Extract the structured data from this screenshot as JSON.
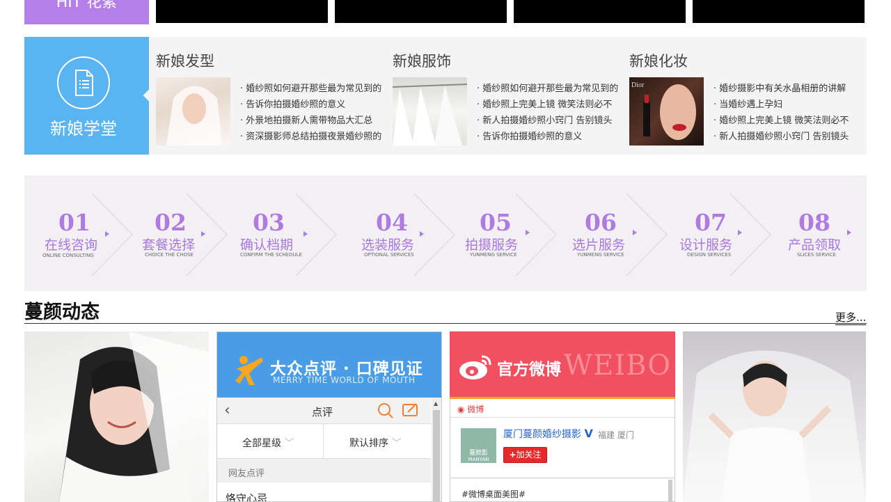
{
  "top": {
    "purple_label": "HIT 花絮"
  },
  "school": {
    "side_title": "新娘学堂",
    "columns": [
      {
        "title": "新娘发型",
        "links": [
          "婚纱照如何避开那些最为常见到的",
          "告诉你拍摄婚纱照的意义",
          "外景地拍摄新人需带物品大汇总",
          "资深摄影师总结拍摄夜景婚纱照的"
        ]
      },
      {
        "title": "新娘服饰",
        "links": [
          "婚纱照如何避开那些最为常见到的",
          "婚纱照上完美上镜 微笑法则必不",
          "新人拍摄婚纱照小窍门 告别镜头",
          "告诉你拍摄婚纱照的意义"
        ]
      },
      {
        "title": "新娘化妆",
        "links": [
          "婚纱摄影中有关水晶相册的讲解",
          "当婚纱遇上孕妇",
          "婚纱照上完美上镜 微笑法则必不",
          "新人拍摄婚纱照小窍门 告别镜头"
        ]
      }
    ]
  },
  "steps": [
    {
      "num": "01",
      "cn": "在线咨询",
      "en": "ONLINE CONSULTING"
    },
    {
      "num": "02",
      "cn": "套餐选择",
      "en": "CHOICE THE CHOSE"
    },
    {
      "num": "03",
      "cn": "确认档期",
      "en": "CONFIRM THE SCHEDULE"
    },
    {
      "num": "04",
      "cn": "选装服务",
      "en": "OPTIONAL SERVICES"
    },
    {
      "num": "05",
      "cn": "拍摄服务",
      "en": "YUNMENG SERVICE"
    },
    {
      "num": "06",
      "cn": "选片服务",
      "en": "YUNMENG SERVICE"
    },
    {
      "num": "07",
      "cn": "设计服务",
      "en": "DESIGN SERVICES"
    },
    {
      "num": "08",
      "cn": "产品领取",
      "en": "SLICES SERVICE"
    }
  ],
  "news": {
    "title": "蔓颜动态",
    "more": "更多..."
  },
  "dianping": {
    "header_title": "大众点评 · 口碑见证",
    "header_sub": "MERRY TIME WORLD OF MOUTH",
    "bar_title": "点评",
    "filter_stars": "全部星级",
    "filter_sort": "默认排序",
    "section": "网友点评",
    "first_user": "恪守心忌"
  },
  "weibo": {
    "header_title": "官方微博",
    "header_en": "WEIBO",
    "bar_label": "微博",
    "account": "厦门蔓颜婚纱摄影",
    "verified": "V",
    "location": "福建 厦门",
    "follow": "加关注",
    "logo_text_top": "蔓颜影",
    "logo_text_bottom": "MANYAN",
    "post": "#微博桌面美图#"
  },
  "colors": {
    "purple": "#b47fe8",
    "blue": "#5ab4f0",
    "steps_accent": "#b07be0",
    "dianping_blue": "#4a9de4",
    "weibo_red": "#f05060"
  }
}
